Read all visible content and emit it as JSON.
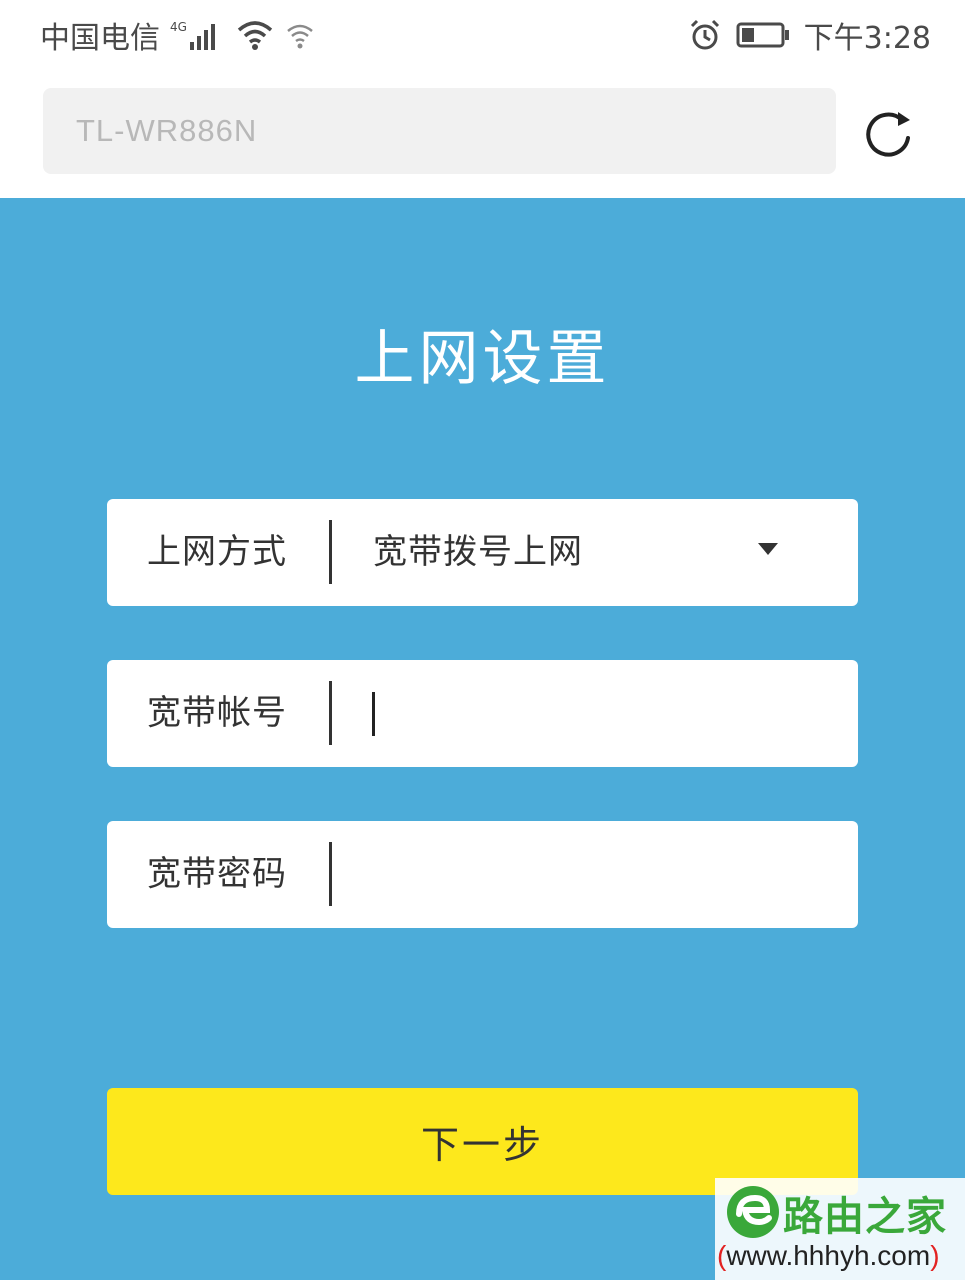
{
  "status_bar": {
    "carrier": "中国电信",
    "network_type": "4G",
    "time": "下午3:28",
    "icons": [
      "signal-icon",
      "wifi-icon",
      "hotspot-icon",
      "alarm-icon",
      "battery-icon"
    ]
  },
  "browser": {
    "address": "TL-WR886N",
    "reload_icon": "reload-icon"
  },
  "page": {
    "title": "上网设置",
    "fields": [
      {
        "label": "上网方式",
        "value": "宽带拨号上网",
        "type": "select"
      },
      {
        "label": "宽带帐号",
        "value": "",
        "type": "text"
      },
      {
        "label": "宽带密码",
        "value": "",
        "type": "password"
      }
    ],
    "next_button": "下一步"
  },
  "watermark": {
    "name": "路由之家",
    "url_open": "(",
    "url": "www.hhhyh.com",
    "url_close": ")"
  },
  "colors": {
    "background": "#4cacd9",
    "button": "#fde81c",
    "field": "#ffffff"
  }
}
